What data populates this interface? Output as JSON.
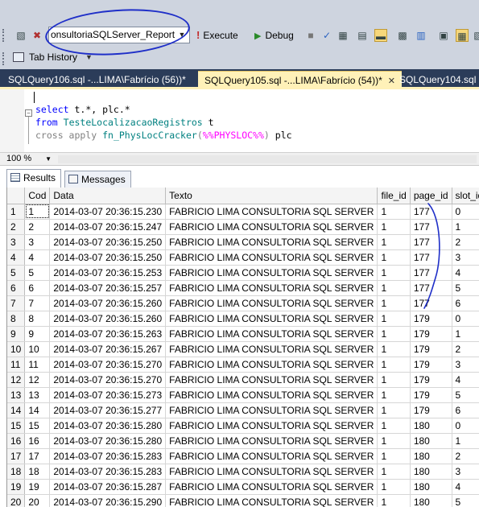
{
  "toolbar": {
    "database_selected": "onsultoriaSQLServer_Report",
    "execute_label": "Execute",
    "debug_label": "Debug",
    "tab_history_label": "Tab History"
  },
  "doc_tabs": [
    {
      "label": "SQLQuery106.sql -...LIMA\\Fabrício (56))*",
      "active": false
    },
    {
      "label": "SQLQuery105.sql -...LIMA\\Fabrício (54))*",
      "active": true
    },
    {
      "label": "SQLQuery104.sql -",
      "active": false
    }
  ],
  "editor": {
    "lines": [
      {
        "parts": [
          [
            "kw",
            "select"
          ],
          [
            "tx",
            " t.*, plc.*"
          ]
        ]
      },
      {
        "parts": [
          [
            "kw",
            "from"
          ],
          [
            "tx",
            " "
          ],
          [
            "tl",
            "TesteLocalizacaoRegistros"
          ],
          [
            "tx",
            " t"
          ]
        ]
      },
      {
        "parts": [
          [
            "gr",
            "cross apply"
          ],
          [
            "tx",
            " "
          ],
          [
            "fn",
            "fn_PhysLocCracker"
          ],
          [
            "gr",
            "("
          ],
          [
            "sv",
            "%%PHYSLOC%%"
          ],
          [
            "gr",
            ")"
          ],
          [
            "tx",
            " plc"
          ]
        ]
      }
    ]
  },
  "zoom": "100 %",
  "result_tabs": {
    "results_label": "Results",
    "messages_label": "Messages"
  },
  "grid": {
    "columns": [
      "",
      "Cod",
      "Data",
      "Texto",
      "file_id",
      "page_id",
      "slot_id"
    ],
    "rows": [
      [
        "1",
        "1",
        "2014-03-07 20:36:15.230",
        "FABRICIO LIMA CONSULTORIA SQL SERVER",
        "1",
        "177",
        "0"
      ],
      [
        "2",
        "2",
        "2014-03-07 20:36:15.247",
        "FABRICIO LIMA CONSULTORIA SQL SERVER",
        "1",
        "177",
        "1"
      ],
      [
        "3",
        "3",
        "2014-03-07 20:36:15.250",
        "FABRICIO LIMA CONSULTORIA SQL SERVER",
        "1",
        "177",
        "2"
      ],
      [
        "4",
        "4",
        "2014-03-07 20:36:15.250",
        "FABRICIO LIMA CONSULTORIA SQL SERVER",
        "1",
        "177",
        "3"
      ],
      [
        "5",
        "5",
        "2014-03-07 20:36:15.253",
        "FABRICIO LIMA CONSULTORIA SQL SERVER",
        "1",
        "177",
        "4"
      ],
      [
        "6",
        "6",
        "2014-03-07 20:36:15.257",
        "FABRICIO LIMA CONSULTORIA SQL SERVER",
        "1",
        "177",
        "5"
      ],
      [
        "7",
        "7",
        "2014-03-07 20:36:15.260",
        "FABRICIO LIMA CONSULTORIA SQL SERVER",
        "1",
        "177",
        "6"
      ],
      [
        "8",
        "8",
        "2014-03-07 20:36:15.260",
        "FABRICIO LIMA CONSULTORIA SQL SERVER",
        "1",
        "179",
        "0"
      ],
      [
        "9",
        "9",
        "2014-03-07 20:36:15.263",
        "FABRICIO LIMA CONSULTORIA SQL SERVER",
        "1",
        "179",
        "1"
      ],
      [
        "10",
        "10",
        "2014-03-07 20:36:15.267",
        "FABRICIO LIMA CONSULTORIA SQL SERVER",
        "1",
        "179",
        "2"
      ],
      [
        "11",
        "11",
        "2014-03-07 20:36:15.270",
        "FABRICIO LIMA CONSULTORIA SQL SERVER",
        "1",
        "179",
        "3"
      ],
      [
        "12",
        "12",
        "2014-03-07 20:36:15.270",
        "FABRICIO LIMA CONSULTORIA SQL SERVER",
        "1",
        "179",
        "4"
      ],
      [
        "13",
        "13",
        "2014-03-07 20:36:15.273",
        "FABRICIO LIMA CONSULTORIA SQL SERVER",
        "1",
        "179",
        "5"
      ],
      [
        "14",
        "14",
        "2014-03-07 20:36:15.277",
        "FABRICIO LIMA CONSULTORIA SQL SERVER",
        "1",
        "179",
        "6"
      ],
      [
        "15",
        "15",
        "2014-03-07 20:36:15.280",
        "FABRICIO LIMA CONSULTORIA SQL SERVER",
        "1",
        "180",
        "0"
      ],
      [
        "16",
        "16",
        "2014-03-07 20:36:15.280",
        "FABRICIO LIMA CONSULTORIA SQL SERVER",
        "1",
        "180",
        "1"
      ],
      [
        "17",
        "17",
        "2014-03-07 20:36:15.283",
        "FABRICIO LIMA CONSULTORIA SQL SERVER",
        "1",
        "180",
        "2"
      ],
      [
        "18",
        "18",
        "2014-03-07 20:36:15.283",
        "FABRICIO LIMA CONSULTORIA SQL SERVER",
        "1",
        "180",
        "3"
      ],
      [
        "19",
        "19",
        "2014-03-07 20:36:15.287",
        "FABRICIO LIMA CONSULTORIA SQL SERVER",
        "1",
        "180",
        "4"
      ],
      [
        "20",
        "20",
        "2014-03-07 20:36:15.290",
        "FABRICIO LIMA CONSULTORIA SQL SERVER",
        "1",
        "180",
        "5"
      ]
    ]
  },
  "colors": {
    "toolbar_bg": "#ced4df",
    "doc_tab_strip": "#2b3c59",
    "active_tab": "#fff1b8",
    "annotation_pen": "#1f2fc8",
    "keyword": "#0000ff",
    "function": "#008080",
    "system_var": "#ff00ff"
  }
}
